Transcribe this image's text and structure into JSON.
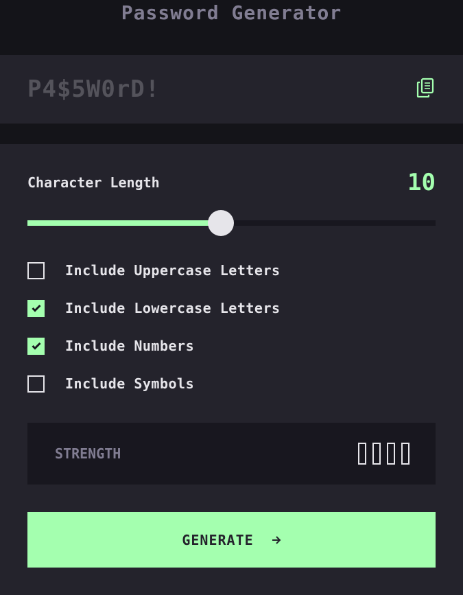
{
  "header": {
    "title": "Password Generator"
  },
  "password": {
    "value": "P4$5W0rD!",
    "copy_icon": "copy-icon"
  },
  "length": {
    "label": "Character Length",
    "value": "10",
    "min": 0,
    "max": 20,
    "fill_fraction": 0.474
  },
  "options": [
    {
      "label": "Include Uppercase Letters",
      "checked": false
    },
    {
      "label": "Include Lowercase Letters",
      "checked": true
    },
    {
      "label": "Include Numbers",
      "checked": true
    },
    {
      "label": "Include Symbols",
      "checked": false
    }
  ],
  "strength": {
    "label": "STRENGTH",
    "level": 0,
    "bars": 4
  },
  "generate": {
    "label": "GENERATE",
    "icon": "arrow-right-icon"
  },
  "colors": {
    "accent": "#a4ffaf",
    "background": "#141419",
    "panel": "#24232c",
    "muted": "#817d92",
    "text": "#e6e5ea"
  }
}
